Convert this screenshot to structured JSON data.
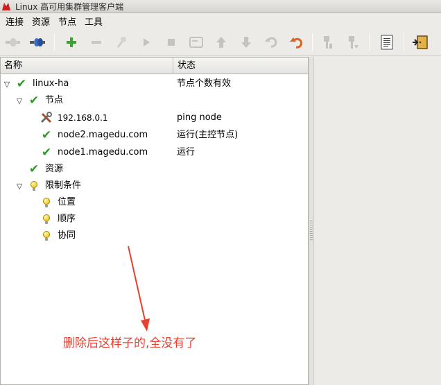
{
  "window": {
    "title": "Linux 高可用集群管理客户端"
  },
  "menu": [
    "连接",
    "资源",
    "节点",
    "工具"
  ],
  "toolbar": {
    "buttons": [
      {
        "name": "connect-icon",
        "glyph": "⊸",
        "enabled": false
      },
      {
        "name": "disconnect-icon",
        "glyph": "⊷",
        "enabled": true
      },
      {
        "name": "add-icon",
        "glyph": "✚",
        "enabled": true
      },
      {
        "name": "remove-icon",
        "glyph": "━",
        "enabled": false
      },
      {
        "name": "cleanup-icon",
        "glyph": "✎",
        "enabled": false
      },
      {
        "name": "start-icon",
        "glyph": "▶",
        "enabled": false
      },
      {
        "name": "stop-icon",
        "glyph": "■",
        "enabled": false
      },
      {
        "name": "default-icon",
        "glyph": "▭",
        "enabled": false
      },
      {
        "name": "move-up-icon",
        "glyph": "⇧",
        "enabled": false
      },
      {
        "name": "move-down-icon",
        "glyph": "⇩",
        "enabled": false
      },
      {
        "name": "unmigrate-icon",
        "glyph": "↺",
        "enabled": false
      },
      {
        "name": "undo-icon",
        "glyph": "↶",
        "enabled": true
      },
      {
        "name": "standby-icon",
        "glyph": "⊥",
        "enabled": false
      },
      {
        "name": "active-icon",
        "glyph": "⊤",
        "enabled": false
      },
      {
        "name": "log-icon",
        "glyph": "▤",
        "enabled": true
      },
      {
        "name": "exit-icon",
        "glyph": "⇥",
        "enabled": true
      }
    ]
  },
  "columns": {
    "name": "名称",
    "status": "状态"
  },
  "tree": {
    "root": {
      "label": "linux-ha",
      "status": "节点个数有效"
    },
    "nodes_group": {
      "label": "节点"
    },
    "node_ip": {
      "label": "192.168.0.1",
      "status": "ping node"
    },
    "node2": {
      "label": "node2.magedu.com",
      "status": "运行(主控节点)"
    },
    "node1": {
      "label": "node1.magedu.com",
      "status": "运行"
    },
    "resources": {
      "label": "资源"
    },
    "constraints": {
      "label": "限制条件"
    },
    "location": {
      "label": "位置"
    },
    "order": {
      "label": "顺序"
    },
    "colocation": {
      "label": "协同"
    }
  },
  "annotation": {
    "text": "删除后这样子的,全没有了",
    "color": "#e8402e"
  }
}
